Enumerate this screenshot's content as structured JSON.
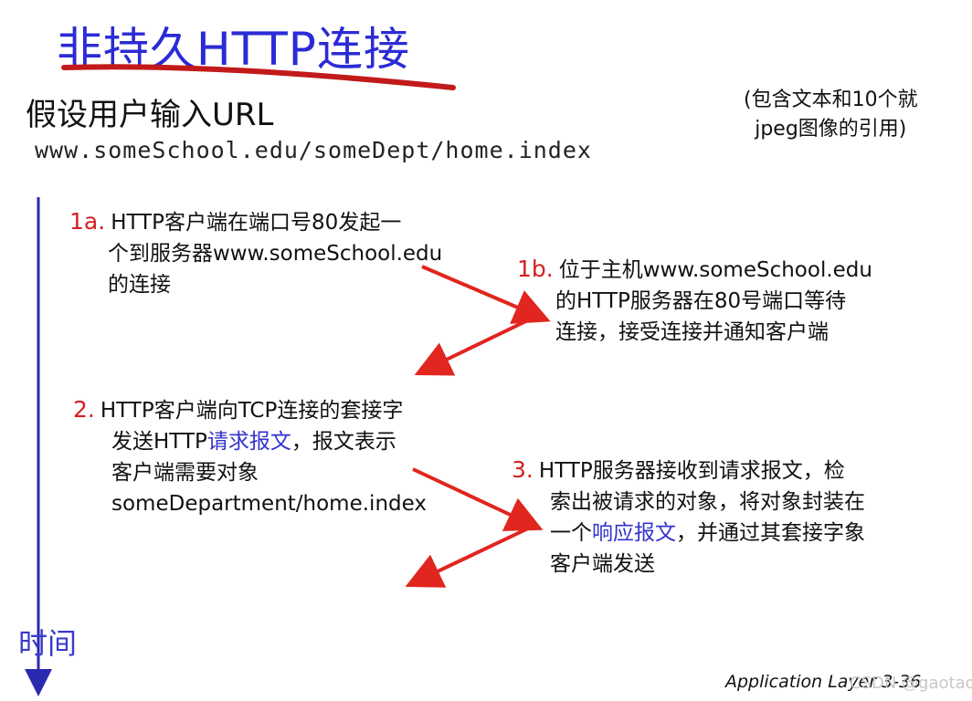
{
  "title": "非持久HTTP连接",
  "subtitle": "假设用户输入URL",
  "url": "www.someSchool.edu/someDept/home.index",
  "note": {
    "line1": "(包含文本和10个就",
    "line2": "jpeg图像的引用)"
  },
  "steps": {
    "s1a": {
      "num": "1a.",
      "lines": [
        "HTTP客户端在端口号80发起一",
        "个到服务器www.someSchool.edu",
        "的连接"
      ]
    },
    "s1b": {
      "num": "1b.",
      "lines": [
        "位于主机www.someSchool.edu",
        "的HTTP服务器在80号端口等待",
        "连接，接受连接并通知客户端"
      ]
    },
    "s2": {
      "num": "2.",
      "line1": "HTTP客户端向TCP连接的套接字",
      "line2_pre": "发送HTTP",
      "line2_link": "请求报文",
      "line2_post": "，报文表示",
      "line3": "客户端需要对象",
      "line4": "someDepartment/home.index"
    },
    "s3": {
      "num": "3.",
      "line1": "HTTP服务器接收到请求报文，检",
      "line2": "索出被请求的对象，将对象封装在",
      "line3_pre": "一个",
      "line3_link": "响应报文",
      "line3_post": "，并通过其套接字象",
      "line4": "客户端发送"
    }
  },
  "time_label": "时间",
  "footer": "Application Layer   3-36",
  "watermark": "CSDN @gaotaola",
  "colors": {
    "title_blue": "#2b2bd6",
    "step_red": "#d42020",
    "arrow_red": "#e0261f",
    "link_blue": "#3333cc",
    "timeline_blue": "#3a3acc"
  }
}
